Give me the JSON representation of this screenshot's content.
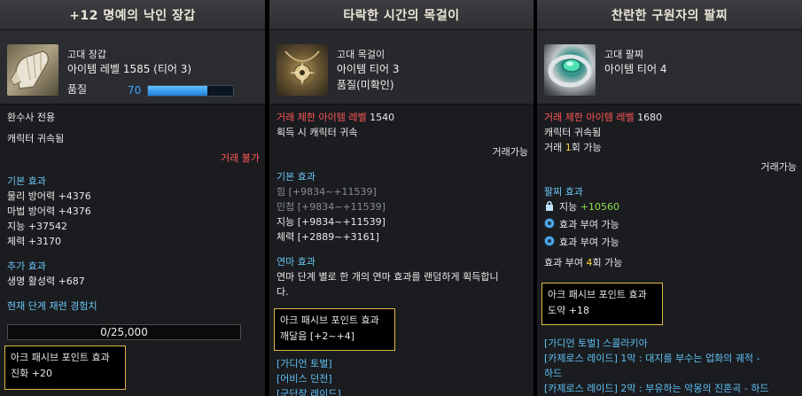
{
  "panel1": {
    "title": "+12 명예의 낙인 장갑",
    "grade": "고대 장갑",
    "item_level": "아이템 레벨 1585 (티어 3)",
    "quality_label": "품질",
    "quality_value": "70",
    "quality_fraction": 0.7,
    "lines": [
      "환수사 전용",
      "캐릭터 귀속됨"
    ],
    "trade": "거래 불가",
    "basic_title": "기본 효과",
    "basic": [
      "물리 방어력 +4376",
      "마법 방어력 +4376",
      "지능 +37542",
      "체력 +3170"
    ],
    "extra_title": "추가 효과",
    "extra": [
      "생명 활성력 +687"
    ],
    "exp_title": "현재 단계 재련 경험치",
    "exp_value": "0/25,000",
    "ark_title": "아크 패시브 포인트 효과",
    "ark_value": "진화 +20"
  },
  "panel2": {
    "title": "타락한 시간의 목걸이",
    "grade": "고대 목걸이",
    "item_tier": "아이템 티어 3",
    "quality": "품질(미확인)",
    "restrict_label": "거래 제한 아이템 레벨",
    "restrict_value": " 1540",
    "bind": "획득 시 캐릭터 귀속",
    "trade": "거래가능",
    "basic_title": "기본 효과",
    "basic_dim": [
      "힘 [+9834~+11539]",
      "민첩 [+9834~+11539]"
    ],
    "basic": [
      "지능 [+9834~+11539]",
      "체력 [+2889~+3161]"
    ],
    "refine_title": "연마 효과",
    "refine_desc1": "연마 단계 별로 한 개의 연마 효과를 랜덤하게 획득합니",
    "refine_desc2": "다.",
    "ark_title": "아크 패시브 포인트 효과",
    "ark_value": "깨달음 [+2~+4]",
    "links": [
      "[가디언 토벌]",
      "[어비스 던전]",
      "[군단장 레이드]"
    ]
  },
  "panel3": {
    "title": "찬란한 구원자의 팔찌",
    "grade": "고대 팔찌",
    "item_tier": "아이템 티어 4",
    "restrict_label": "거래 제한 아이템 레벨",
    "restrict_value": " 1680",
    "bind": "캐릭터 귀속됨",
    "trade_count_pre": "거래 ",
    "trade_count_num": "1",
    "trade_count_post": "회 가능",
    "trade": "거래가능",
    "effect_title": "팔찌 효과",
    "effect_stat": "지능 ",
    "effect_value": "+10560",
    "grant1": "효과 부여 가능",
    "grant2": "효과 부여 가능",
    "grant_count_pre": "효과 부여 ",
    "grant_count_num": "4",
    "grant_count_post": "회 가능",
    "ark_title": "아크 패시브 포인트 효과",
    "ark_value": "도약 +18",
    "links": [
      "[가디언 토벌] 스콜라키아",
      "[카제로스 레이드] 1막 : 대지를 부수는 업화의 궤적 -",
      "하드",
      "[카제로스 레이드] 2막 : 부유하는 악몽의 진혼곡 - 하드"
    ]
  }
}
